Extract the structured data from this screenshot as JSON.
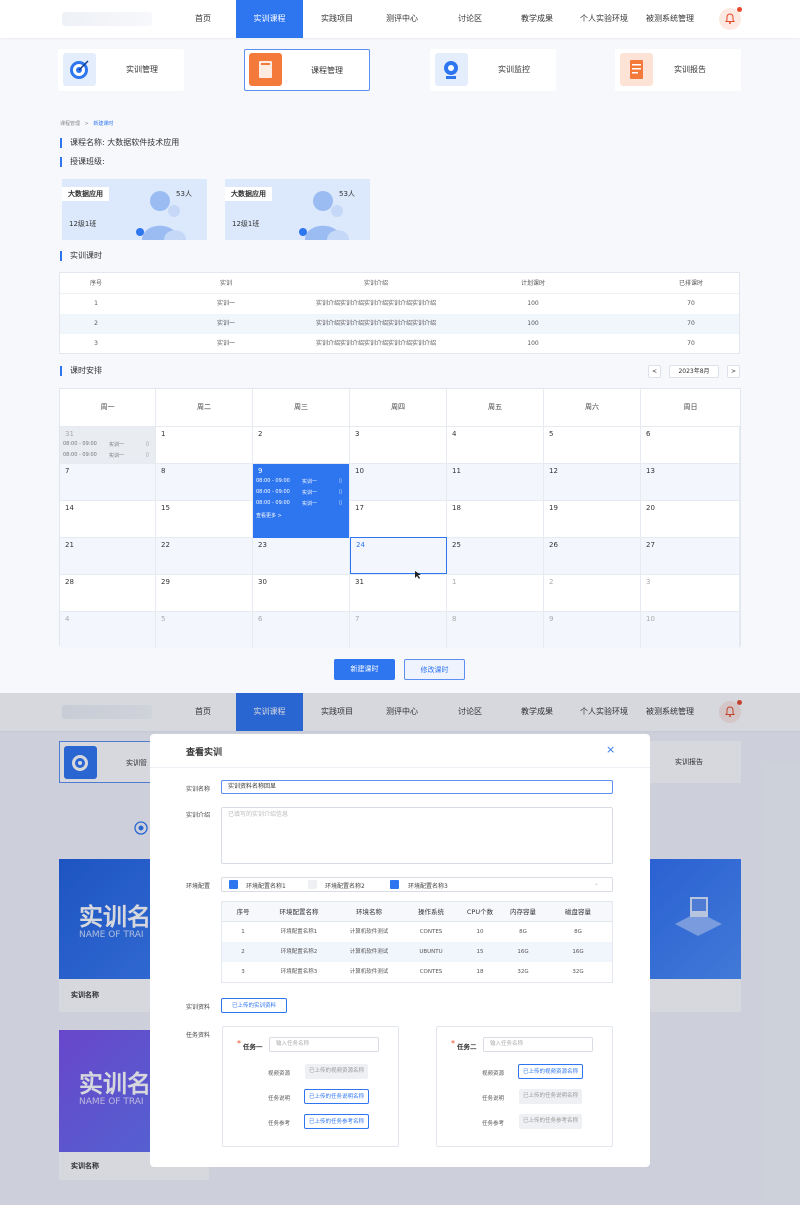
{
  "nav": {
    "items": [
      "首页",
      "实训课程",
      "实践项目",
      "测评中心",
      "讨论区",
      "教学成果",
      "个人实验环境",
      "被测系统管理"
    ],
    "active_index": 1
  },
  "cards": [
    "实训管理",
    "课程管理",
    "实训监控",
    "实训报告"
  ],
  "breadcrumb": {
    "root": "课程管理",
    "sep": ">",
    "current": "新建课时"
  },
  "course": {
    "name_label": "课程名称: 大数据软件技术应用",
    "class_label": "授课班级:"
  },
  "classes": [
    {
      "tag": "大数据应用",
      "count": "53人",
      "name": "12级1班"
    },
    {
      "tag": "大数据应用",
      "count": "53人",
      "name": "12级1班"
    }
  ],
  "hours_title": "实训课时",
  "hours_table": {
    "headers": [
      "序号",
      "实训",
      "实训介绍",
      "计划课时",
      "已排课时"
    ],
    "rows": [
      [
        "1",
        "实训一",
        "实训介绍实训介绍实训介绍实训介绍实训介绍",
        "100",
        "70"
      ],
      [
        "2",
        "实训一",
        "实训介绍实训介绍实训介绍实训介绍实训介绍",
        "100",
        "70"
      ],
      [
        "3",
        "实训一",
        "实训介绍实训介绍实训介绍实训介绍实训介绍",
        "100",
        "70"
      ]
    ]
  },
  "schedule": {
    "title": "课时安排",
    "prev": "<",
    "next": ">",
    "month": "2023年8月",
    "weekdays": [
      "周一",
      "周二",
      "周三",
      "周四",
      "周五",
      "周六",
      "周日"
    ],
    "days": [
      [
        "31",
        "1",
        "2",
        "3",
        "4",
        "5",
        "6"
      ],
      [
        "7",
        "8",
        "9",
        "10",
        "11",
        "12",
        "13"
      ],
      [
        "14",
        "15",
        "16",
        "17",
        "18",
        "19",
        "20"
      ],
      [
        "21",
        "22",
        "23",
        "24",
        "25",
        "26",
        "27"
      ],
      [
        "28",
        "29",
        "30",
        "31",
        "1",
        "2",
        "3"
      ],
      [
        "4",
        "5",
        "6",
        "7",
        "8",
        "9",
        "10"
      ]
    ],
    "event_time": "08:00 - 09:00",
    "event_name": "实训一",
    "more": "查看更多 >"
  },
  "buttons": {
    "new": "新建课时",
    "edit": "修改课时"
  },
  "modal": {
    "title": "查看实训",
    "close": "×",
    "name_label": "实训名称",
    "name_value": "实训资料名称回显",
    "intro_label": "实训介绍",
    "intro_placeholder": "已填写的实训介绍信息",
    "env_label": "环境配置",
    "env_options": [
      "环境配置名称1",
      "环境配置名称2",
      "环境配置名称3"
    ],
    "env_table": {
      "headers": [
        "序号",
        "环境配置名称",
        "环境名称",
        "操作系统",
        "CPU个数",
        "内存容量",
        "磁盘容量"
      ],
      "rows": [
        [
          "1",
          "环境配置名称1",
          "计算机软件测试",
          "CONTES",
          "10",
          "8G",
          "8G"
        ],
        [
          "2",
          "环境配置名称2",
          "计算机软件测试",
          "UBUNTU",
          "15",
          "16G",
          "16G"
        ],
        [
          "3",
          "环境配置名称3",
          "计算机软件测试",
          "CONTES",
          "18",
          "32G",
          "32G"
        ]
      ]
    },
    "material_label": "实训资料",
    "material_btn": "已上传的实训资料",
    "task_label": "任务资料",
    "tasks": [
      {
        "star": "*",
        "name": "任务一",
        "placeholder": "输入任务名称",
        "video_label": "视频资源",
        "video": "已上传的视频资源名称",
        "desc_label": "任务说明",
        "desc": "已上传的任务说明名称",
        "ref_label": "任务参考",
        "ref": "已上传的任务参考名称"
      },
      {
        "star": "*",
        "name": "任务二",
        "placeholder": "输入任务名称",
        "video_label": "视频资源",
        "video": "已上传的视频资源名称",
        "desc_label": "任务说明",
        "desc": "已上传的任务说明名称",
        "ref_label": "任务参考",
        "ref": "已上传的任务参考名称"
      }
    ]
  },
  "background_page": {
    "banner1_title": "实训名",
    "banner1_sub": "NAME OF TRAI",
    "banner1_caption": "实训名称",
    "banner2_title": "实训名",
    "banner2_sub": "NAME OF TRAI",
    "banner2_caption": "实训名称",
    "card_first": "实训管",
    "card_last": "实训报告"
  },
  "colors": {
    "accent": "#2e75f0",
    "alert": "#e84a2a"
  }
}
